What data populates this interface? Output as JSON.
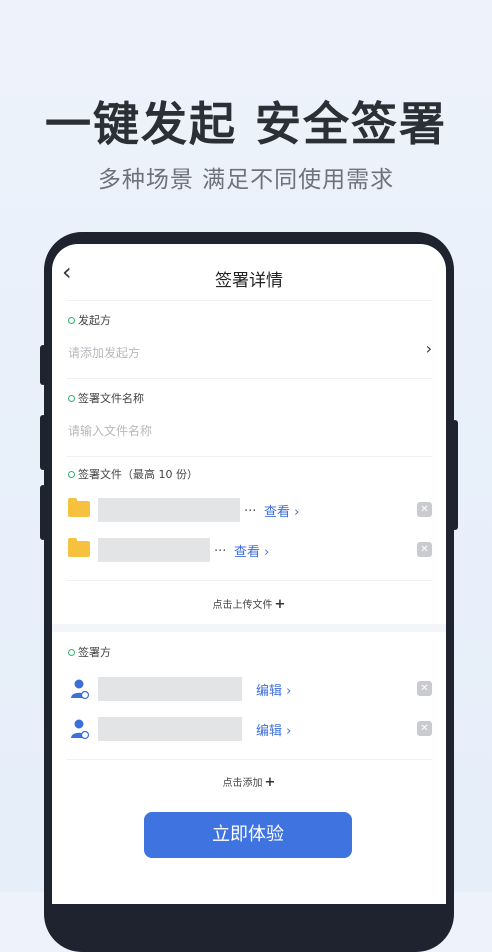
{
  "hero": {
    "title": "一键发起 安全签署",
    "subtitle": "多种场景 满足不同使用需求"
  },
  "nav": {
    "back_icon": "‹",
    "title": "签署详情"
  },
  "initiator": {
    "label": "发起方",
    "placeholder": "请添加发起方",
    "chevron": "›"
  },
  "filename": {
    "label": "签署文件名称",
    "placeholder": "请输入文件名称"
  },
  "files": {
    "label": "签署文件（最高 10 份）",
    "items": [
      {
        "ellipsis": "...",
        "view": "查看 ›"
      },
      {
        "ellipsis": "...",
        "view": "查看 ›"
      }
    ],
    "upload": "点击上传文件",
    "upload_plus": "+"
  },
  "signers": {
    "label": "签署方",
    "items": [
      {
        "edit": "编辑 ›"
      },
      {
        "edit": "编辑 ›"
      }
    ],
    "add": "点击添加",
    "add_plus": "+"
  },
  "cta": {
    "label": "立即体验"
  },
  "colors": {
    "accent": "#3e73e0",
    "folder": "#f6c23e",
    "dot": "#2fb46f"
  }
}
